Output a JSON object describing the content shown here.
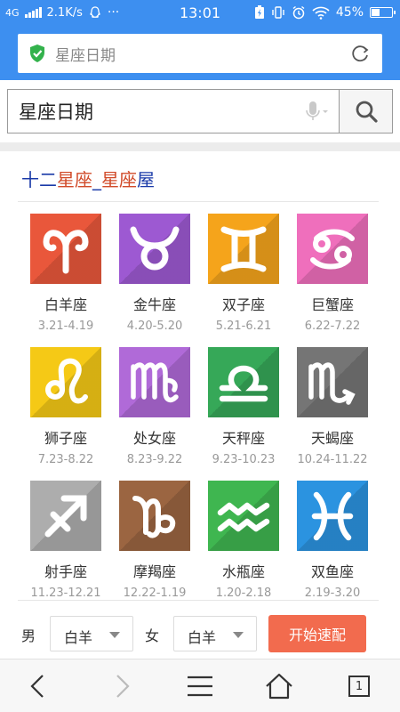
{
  "status_bar": {
    "network": "4G",
    "speed": "2.1K/s",
    "more": "···",
    "time": "13:01",
    "battery": "45%",
    "battery_level": 0.45
  },
  "address_bar": {
    "text": "星座日期",
    "secure_icon": "shield-check-icon",
    "reload_icon": "reload-icon"
  },
  "search": {
    "query": "星座日期",
    "mic_icon": "microphone-icon",
    "button_icon": "search-icon"
  },
  "heading": {
    "part1": "十二",
    "part2": "星座",
    "part3": "_",
    "part4": "星座",
    "part5": "屋"
  },
  "zodiac": [
    {
      "name": "白羊座",
      "dates": "3.21-4.19",
      "icon": "aries-icon",
      "color": "#e9573b"
    },
    {
      "name": "金牛座",
      "dates": "4.20-5.20",
      "icon": "taurus-icon",
      "color": "#9d59d2"
    },
    {
      "name": "双子座",
      "dates": "5.21-6.21",
      "icon": "gemini-icon",
      "color": "#f5a41b"
    },
    {
      "name": "巨蟹座",
      "dates": "6.22-7.22",
      "icon": "cancer-icon",
      "color": "#ef6fbc"
    },
    {
      "name": "狮子座",
      "dates": "7.23-8.22",
      "icon": "leo-icon",
      "color": "#f5c916"
    },
    {
      "name": "处女座",
      "dates": "8.23-9.22",
      "icon": "virgo-icon",
      "color": "#b06ad8"
    },
    {
      "name": "天秤座",
      "dates": "9.23-10.23",
      "icon": "libra-icon",
      "color": "#36a858"
    },
    {
      "name": "天蝎座",
      "dates": "10.24-11.22",
      "icon": "scorpio-icon",
      "color": "#757575"
    },
    {
      "name": "射手座",
      "dates": "11.23-12.21",
      "icon": "sagittarius-icon",
      "color": "#adadad"
    },
    {
      "name": "摩羯座",
      "dates": "12.22-1.19",
      "icon": "capricorn-icon",
      "color": "#9b6541"
    },
    {
      "name": "水瓶座",
      "dates": "1.20-2.18",
      "icon": "aquarius-icon",
      "color": "#3fb650"
    },
    {
      "name": "双鱼座",
      "dates": "2.19-3.20",
      "icon": "pisces-icon",
      "color": "#2b93e0"
    }
  ],
  "pairing": {
    "male_label": "男",
    "male_value": "白羊",
    "female_label": "女",
    "female_value": "白羊",
    "start_label": "开始速配",
    "start_color": "#f26b4e"
  },
  "bottom_nav": {
    "tab_count": "1"
  },
  "colors": {
    "brand_blue": "#3d8ff0",
    "heading_blue": "#1a3aa8",
    "heading_red": "#d14b2a"
  }
}
